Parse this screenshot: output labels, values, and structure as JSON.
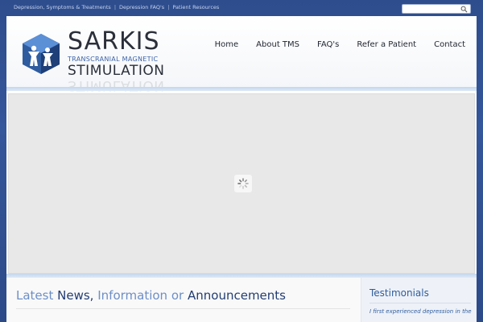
{
  "top_links": [
    "Depression, Symptoms & Treatments",
    "Depression FAQ's",
    "Patient Resources"
  ],
  "top_link_separator": "|",
  "search": {
    "placeholder": "",
    "icon": "search-icon"
  },
  "logo": {
    "title": "SARKIS",
    "subtitle": "TRANSCRANIAL MAGNETIC",
    "subtitle2": "STIMULATION",
    "colors": {
      "blue": "#2f5c9e",
      "dark": "#2b2f3a"
    }
  },
  "nav": [
    "Home",
    "About TMS",
    "FAQ's",
    "Refer a Patient",
    "Contact"
  ],
  "latest": {
    "part1": "Latest",
    "part2": "News,",
    "part3": "Information",
    "part4": "or",
    "part5": "Announcements"
  },
  "sidebar": {
    "title": "Testimonials",
    "text": "I first experienced depression in the"
  },
  "colors": {
    "background": "#34569a",
    "accent": "#2f5c9e",
    "divider": "#c3d6ee"
  }
}
